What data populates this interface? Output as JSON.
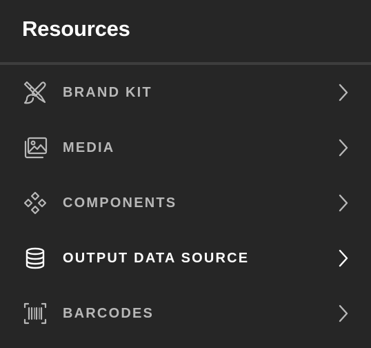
{
  "panel": {
    "title": "Resources"
  },
  "menu": {
    "items": [
      {
        "label": "BRAND KIT",
        "icon": "brush-pencil-icon",
        "active": false
      },
      {
        "label": "MEDIA",
        "icon": "images-icon",
        "active": false
      },
      {
        "label": "COMPONENTS",
        "icon": "components-icon",
        "active": false
      },
      {
        "label": "OUTPUT DATA SOURCE",
        "icon": "database-icon",
        "active": true
      },
      {
        "label": "BARCODES",
        "icon": "barcode-icon",
        "active": false
      }
    ]
  },
  "colors": {
    "background": "#262626",
    "divider": "#3d3d3d",
    "text_default": "#b8b8b8",
    "text_active": "#ffffff"
  }
}
